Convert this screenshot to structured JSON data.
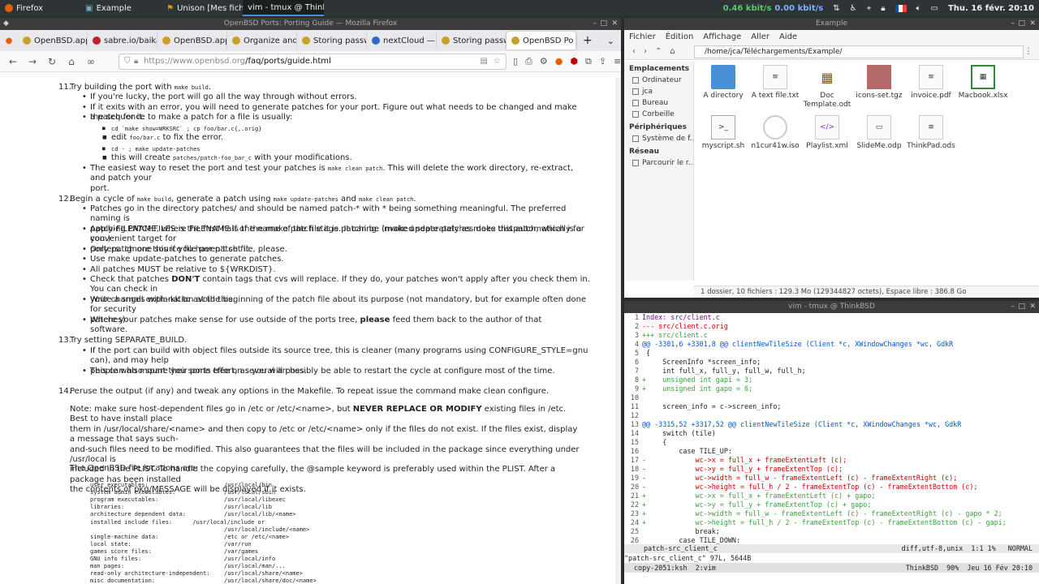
{
  "panel": {
    "launcher": "Firefox",
    "tasks": [
      "Example",
      "Unison [Mes fichie...",
      "vim - tmux @ Think..."
    ],
    "net_down": "0.46 kbit/s",
    "net_up": "0.00 kbit/s",
    "clock": "Thu. 16 févr. 20:10"
  },
  "firefox": {
    "title": "OpenBSD Ports: Porting Guide — Mozilla Firefox",
    "tabs": [
      {
        "label": "OpenBSD.app",
        "color": "#c8a02a"
      },
      {
        "label": "sabre.io/baikal",
        "color": "#c0202a"
      },
      {
        "label": "OpenBSD.app",
        "color": "#c8a02a"
      },
      {
        "label": "Organize and s",
        "color": "#c8a02a"
      },
      {
        "label": "Storing passw",
        "color": "#c8a02a"
      },
      {
        "label": "nextCloud — vdirs",
        "color": "#2a6ac8"
      },
      {
        "label": "Storing password",
        "color": "#c8a02a"
      },
      {
        "label": "OpenBSD Po",
        "color": "#c8a02a"
      }
    ],
    "url_host": "https://www.openbsd.org",
    "url_path": "/faq/ports/guide.html"
  },
  "page": {
    "s11": {
      "num": "11.",
      "head": "Try building the port with ",
      "cmd": "make build",
      "tail": ".",
      "b1": "If you're lucky, the port will go all the way through without errors.",
      "b2": "If it exits with an error, you will need to generate patches for your port. Figure out what needs to be changed and make a patch for it.",
      "b3": "the sequence to make a patch for a file is usually:",
      "sq1": "cd `make show=WRKSRC` ; cp foo/bar.c{,.orig}",
      "sq2a": "edit ",
      "sq2b": "foo/bar.c",
      "sq2c": " to fix the error.",
      "sq3": "cd - ; make update-patches",
      "sq4a": "this will create ",
      "sq4b": "patches/patch-foo_bar_c",
      "sq4c": " with your modifications.",
      "b4a": "The easiest way to reset the port and test your patches is ",
      "b4b": "make clean patch",
      "b4c": ". This will delete the work directory, re-extract, and patch your",
      "b4d": "port."
    },
    "s12": {
      "num": "12.",
      "h1": "Begin a cycle of ",
      "h2": "make build",
      "h3": ", generate a patch using ",
      "h4": "make update-patches",
      "h5": " and ",
      "h6": "make clean patch",
      "h7": ".",
      "l1": "Patches go in the directory patches/ and should be named patch-* with * being something meaningful. The preferred naming is",
      "l2": "patch-FILENAME, where FILENAME is the name of the file it is patching. (make update-patches does this automatically for you.)",
      "l3": "Applying PATCHFILES is the first half of the make patch stage. It can be invoked separately as make distpatch, which is a convenient target for",
      "l4": "porters. Ignore this if you haven't set it.",
      "l5": "Only patch one source file per patch file, please.",
      "l6": "Use make update-patches to generate patches.",
      "l7": "All patches MUST be relative to ${WRKDIST}.",
      "l8a": "Check that patches ",
      "l8b": "DON'T",
      "l8c": " contain tags that cvs will replace. If they do, your patches won't apply after you check them in. You can check in",
      "l9": "your changes with -kk to avoid this.",
      "l10": "Write a small explanation at the beginning of the patch file about its purpose (not mandatory, but for example often done for security",
      "l11": "patches).",
      "l12a": "Where your patches make sense for use outside of the ports tree, ",
      "l12b": "please",
      "l12c": " feed them back to the author of that software."
    },
    "s13": {
      "num": "13.",
      "head": "Try setting SEPARATE_BUILD.",
      "l1": "If the port can build with object files outside its source tree, this is cleaner (many programs using CONFIGURE_STYLE=gnu can), and may help",
      "l2": "people who mount their ports tree on several arches.",
      "l3": "This can also spare you some effort, as you will possibly be able to restart the cycle at configure most of the time."
    },
    "s14": {
      "num": "14.",
      "head": "Peruse the output (if any) and tweak any options in the Makefile. To repeat issue the command make clean configure.",
      "n1a": "Note: make sure host-dependent files go in /etc or /etc/<name>, but ",
      "n1b": "NEVER REPLACE OR MODIFY",
      "n1c": " existing files in /etc. Best to have install place",
      "n2": "them in /usr/local/share/<name> and then copy to /etc or /etc/<name> only if the files do not exist. If the files exist, display a message that says such-",
      "n3": "and-such files need to be modified. This also guarantees that the files will be included in the package since everything under /usr/local is",
      "n4": "included in the PLIST. To handle the copying carefully, the @sample keyword is preferably used within the PLIST. After a package has been installed",
      "n5": "the contents of pkg/MESSAGE will be displayed if it exists.",
      "loc": "The OpenBSD file locations are:"
    },
    "locs": [
      [
        "user executables:",
        "/usr/local/bin"
      ],
      [
        "system admin executables:",
        "/usr/local/sbin"
      ],
      [
        "program executables:",
        "/usr/local/libexec"
      ],
      [
        "libraries:",
        "/usr/local/lib"
      ],
      [
        "architecture dependent data:",
        "/usr/local/lib/<name>"
      ],
      [
        "installed include files:      /usr/local/include or",
        ""
      ],
      [
        "",
        "/usr/local/include/<name>"
      ],
      [
        "single-machine data:",
        "/etc or /etc/<name>"
      ],
      [
        "local state:",
        "/var/run"
      ],
      [
        "games score files:",
        "/var/games"
      ],
      [
        "GNU info files:",
        "/usr/local/info"
      ],
      [
        "man pages:",
        "/usr/local/man/..."
      ],
      [
        "read-only architecture-independent:",
        "/usr/local/share/<name>"
      ],
      [
        "misc documentation:",
        "/usr/local/share/doc/<name>"
      ]
    ]
  },
  "fm": {
    "title": "Example",
    "menu": [
      "Fichier",
      "Édition",
      "Affichage",
      "Aller",
      "Aide"
    ],
    "path": "/home/jca/Téléchargements/Example/",
    "side": {
      "h1": "Emplacements",
      "places": [
        "Ordinateur",
        "jca",
        "Bureau",
        "Corbeille"
      ],
      "h2": "Périphériques",
      "devices": [
        "Système de f..."
      ],
      "h3": "Réseau",
      "network": [
        "Parcourir le r..."
      ]
    },
    "files": [
      {
        "name": "A directory",
        "kind": "folder"
      },
      {
        "name": "A text file.txt",
        "kind": "text"
      },
      {
        "name": "Doc Template.odt",
        "kind": "doc"
      },
      {
        "name": "icons-set.tgz",
        "kind": "archive"
      },
      {
        "name": "invoice.pdf",
        "kind": "pdf"
      },
      {
        "name": "Macbook.xlsx",
        "kind": "sheet"
      },
      {
        "name": "myscript.sh",
        "kind": "script"
      },
      {
        "name": "n1cur41w.iso",
        "kind": "iso"
      },
      {
        "name": "Playlist.xml",
        "kind": "xml"
      },
      {
        "name": "SlideMe.odp",
        "kind": "slides"
      },
      {
        "name": "ThinkPad.ods",
        "kind": "ods"
      }
    ],
    "status": "1 dossier, 10 fichiers : 129.3 Mo (129344827 octets), Espace libre : 386.8 Go"
  },
  "vim": {
    "title": "vim - tmux @ ThinkBSD",
    "lines": [
      [
        "1",
        "Index: src/client.c",
        "hdr"
      ],
      [
        "2",
        "--- src/client.c.orig",
        "minus"
      ],
      [
        "3",
        "+++ src/client.c",
        "plus"
      ],
      [
        "4",
        "@@ -3301,6 +3301,8 @@ clientNewTileSize (Client *c, XWindowChanges *wc, GdkR",
        "hunk"
      ],
      [
        "5",
        " {",
        ""
      ],
      [
        "6",
        "     ScreenInfo *screen_info;",
        ""
      ],
      [
        "7",
        "     int full_x, full_y, full_w, full_h;",
        ""
      ],
      [
        "8",
        "+    unsigned int gapi = 3;",
        "plus"
      ],
      [
        "9",
        "+    unsigned int gapo = 6;",
        "plus"
      ],
      [
        "10",
        "",
        ""
      ],
      [
        "11",
        "     screen_info = c->screen_info;",
        ""
      ],
      [
        "12",
        "",
        ""
      ],
      [
        "13",
        "@@ -3315,52 +3317,52 @@ clientNewTileSize (Client *c, XWindowChanges *wc, GdkR",
        "hunk"
      ],
      [
        "14",
        "     switch (tile)",
        ""
      ],
      [
        "15",
        "     {",
        ""
      ],
      [
        "16",
        "         case TILE_UP:",
        ""
      ],
      [
        "17",
        "-            wc->x = full_x + frameExtentLeft (c);",
        "minus"
      ],
      [
        "18",
        "-            wc->y = full_y + frameExtentTop (c);",
        "minus"
      ],
      [
        "19",
        "-            wc->width = full_w - frameExtentLeft (c) - frameExtentRight (c);",
        "minus"
      ],
      [
        "20",
        "-            wc->height = full_h / 2 - frameExtentTop (c) - frameExtentBottom (c);",
        "minus"
      ],
      [
        "21",
        "+            wc->x = full_x + frameExtentLeft (c) + gapo;",
        "plus"
      ],
      [
        "22",
        "+            wc->y = full_y + frameExtentTop (c) + gapo;",
        "plus"
      ],
      [
        "23",
        "+            wc->width = full_w - frameExtentLeft (c) - frameExtentRight (c) - gapo * 2;",
        "plus"
      ],
      [
        "24",
        "+            wc->height = full_h / 2 - frameExtentTop (c) - frameExtentBottom (c) - gapi;",
        "plus"
      ],
      [
        "25",
        "             break;",
        ""
      ],
      [
        "26",
        "         case TILE_DOWN:",
        ""
      ]
    ],
    "status_left": "patch-src_client_c",
    "status_right": "diff,utf-8,unix  1:1 1%   NORMAL",
    "cmdline": "\"patch-src_client_c\" 97L, 5644B",
    "tmux_left": "copy-2051:ksh  2:vim",
    "tmux_right": "ThinkBSD  90%  Jeu 16 Fév 20:10"
  }
}
